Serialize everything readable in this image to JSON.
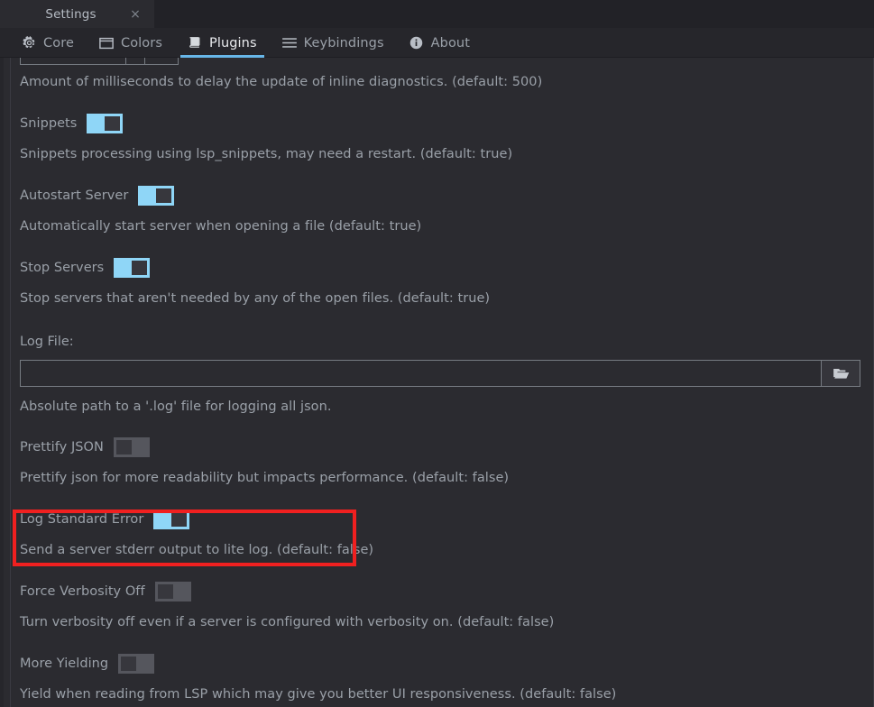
{
  "window": {
    "tab_title": "Settings",
    "close_label": "×"
  },
  "tabstrip": {
    "tabs": [
      {
        "label": "Core",
        "icon": "gear-icon",
        "active": false
      },
      {
        "label": "Colors",
        "icon": "window-icon",
        "active": false
      },
      {
        "label": "Plugins",
        "icon": "book-icon",
        "active": true
      },
      {
        "label": "Keybindings",
        "icon": "list-icon",
        "active": false
      },
      {
        "label": "About",
        "icon": "info-icon",
        "active": false
      }
    ]
  },
  "settings": {
    "diagnostics_delay_desc": "Amount of milliseconds to delay the update of inline diagnostics. (default: 500)",
    "items": [
      {
        "label": "Snippets",
        "state": "on",
        "description": "Snippets processing using lsp_snippets, may need a restart. (default: true)"
      },
      {
        "label": "Autostart Server",
        "state": "on",
        "description": "Automatically start server when opening a file (default: true)"
      },
      {
        "label": "Stop Servers",
        "state": "on",
        "description": "Stop servers that aren't needed by any of the open files. (default: true)"
      },
      {
        "label": "Prettify JSON",
        "state": "off",
        "description": "Prettify json for more readability but impacts performance. (default: false)"
      },
      {
        "label": "Log Standard Error",
        "state": "on",
        "description": "Send a server stderr output to lite log. (default: false)"
      },
      {
        "label": "Force Verbosity Off",
        "state": "off",
        "description": "Turn verbosity off even if a server is configured with verbosity on. (default: false)"
      },
      {
        "label": "More Yielding",
        "state": "off",
        "description": "Yield when reading from LSP which may give you better UI responsiveness. (default: false)"
      }
    ],
    "log_file": {
      "label": "Log File:",
      "value": "",
      "placeholder": "",
      "browse_icon": "folder-open-icon",
      "description": "Absolute path to a '.log' file for logging all json."
    }
  },
  "annotation": {
    "target": "Log Standard Error",
    "color": "#f02020"
  },
  "colors": {
    "background": "#2b2b30",
    "titlebar": "#222227",
    "tabstrip": "#26262b",
    "accent": "#67b6e8",
    "toggle_on": "#8fd6f7",
    "toggle_off": "#55565d",
    "text": "#9aa0a8",
    "text_active": "#e8eaed"
  }
}
